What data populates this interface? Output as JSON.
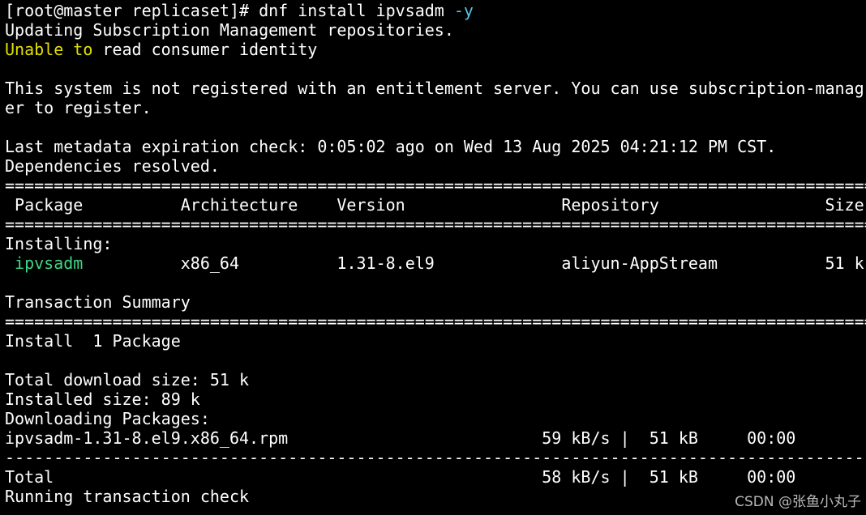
{
  "terminal": {
    "lines": [
      [
        {
          "t": "[root@master replicaset]# dnf install ipvsadm ",
          "c": "default"
        },
        {
          "t": "-y",
          "c": "cyan"
        }
      ],
      [
        {
          "t": "Updating Subscription Management repositories.",
          "c": "default"
        }
      ],
      [
        {
          "t": "Unable to",
          "c": "yellow"
        },
        {
          "t": " read consumer identity",
          "c": "default"
        }
      ],
      [
        {
          "t": "",
          "c": "default"
        }
      ],
      [
        {
          "t": "This system is not registered with an entitlement server. You can use subscription-manag",
          "c": "default"
        }
      ],
      [
        {
          "t": "er to register.",
          "c": "default"
        }
      ],
      [
        {
          "t": "",
          "c": "default"
        }
      ],
      [
        {
          "t": "Last metadata expiration check: 0:05:02 ago on Wed 13 Aug 2025 04:21:12 PM CST.",
          "c": "default"
        }
      ],
      [
        {
          "t": "Dependencies resolved.",
          "c": "default"
        }
      ],
      [
        {
          "t": "==========================================================================================",
          "c": "default"
        }
      ],
      [
        {
          "t": " Package          Architecture    Version                Repository                 Size",
          "c": "default"
        }
      ],
      [
        {
          "t": "==========================================================================================",
          "c": "default"
        }
      ],
      [
        {
          "t": "Installing:",
          "c": "default"
        }
      ],
      [
        {
          "t": " ",
          "c": "default"
        },
        {
          "t": "ipvsadm",
          "c": "green"
        },
        {
          "t": "          x86_64          1.31-8.el9             aliyun-AppStream           51 k",
          "c": "default"
        }
      ],
      [
        {
          "t": "",
          "c": "default"
        }
      ],
      [
        {
          "t": "Transaction Summary",
          "c": "default"
        }
      ],
      [
        {
          "t": "==========================================================================================",
          "c": "default"
        }
      ],
      [
        {
          "t": "Install  1 Package",
          "c": "default"
        }
      ],
      [
        {
          "t": "",
          "c": "default"
        }
      ],
      [
        {
          "t": "Total download size: 51 k",
          "c": "default"
        }
      ],
      [
        {
          "t": "Installed size: 89 k",
          "c": "default"
        }
      ],
      [
        {
          "t": "Downloading Packages:",
          "c": "default"
        }
      ],
      [
        {
          "t": "ipvsadm-1.31-8.el9.x86_64.rpm                          59 kB/s |  51 kB     00:00",
          "c": "default"
        }
      ],
      [
        {
          "t": "------------------------------------------------------------------------------------------",
          "c": "default"
        }
      ],
      [
        {
          "t": "Total                                                  58 kB/s |  51 kB     00:00",
          "c": "default"
        }
      ],
      [
        {
          "t": "Running transaction check",
          "c": "default"
        }
      ]
    ]
  },
  "watermark": "CSDN @张鱼小丸子",
  "colors": {
    "background": "#000000",
    "foreground": "#ffffff",
    "yellow": "#e0e000",
    "cyan": "#52c8e8",
    "green": "#3ed686"
  }
}
